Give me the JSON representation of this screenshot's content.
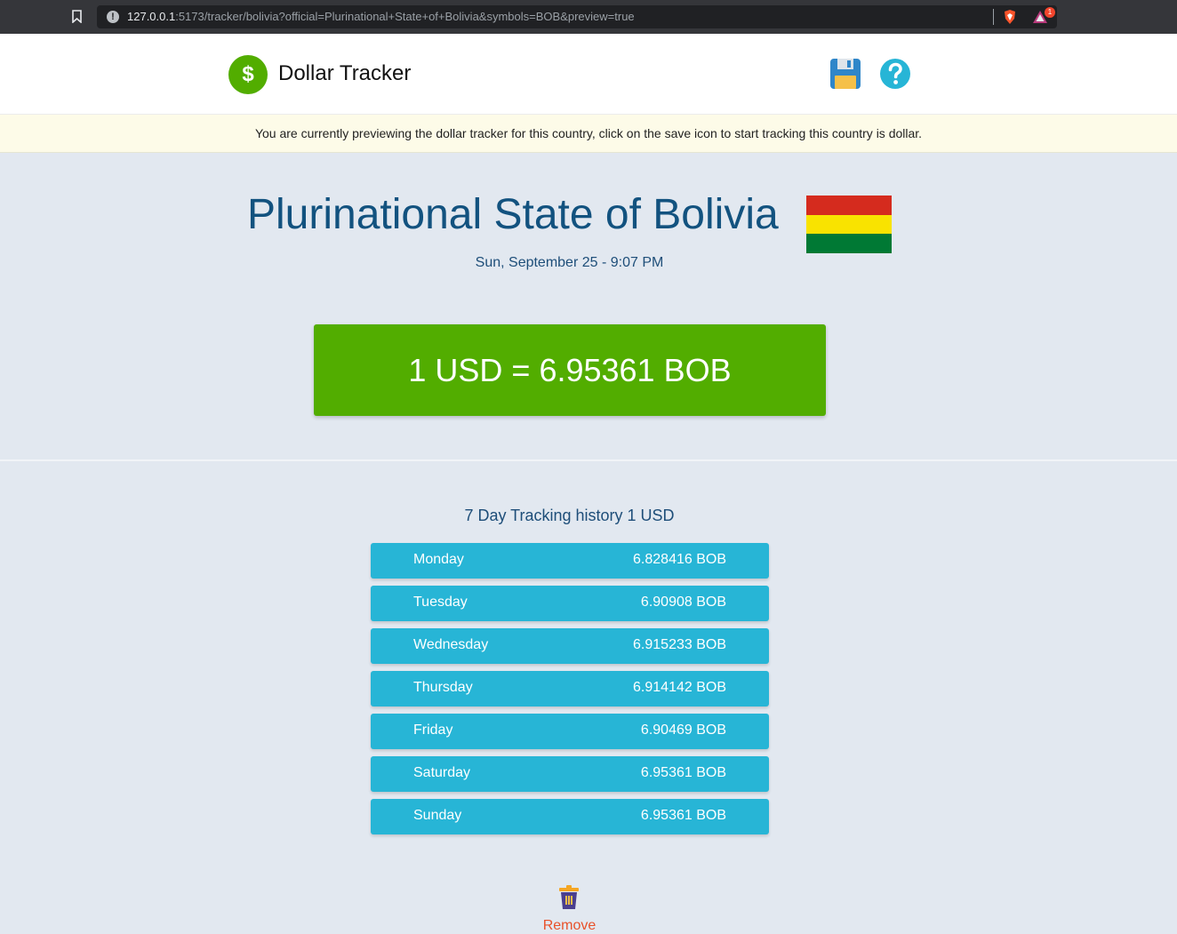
{
  "browser": {
    "url_host": "127.0.0.1",
    "url_rest": ":5173/tracker/bolivia?official=Plurinational+State+of+Bolivia&symbols=BOB&preview=true",
    "rewards_badge": "1"
  },
  "header": {
    "logo_symbol": "$",
    "app_title": "Dollar Tracker",
    "save_icon": "save-icon",
    "help_icon": "help-icon"
  },
  "notice": {
    "text": "You are currently previewing the dollar tracker for this country, click on the save icon to start tracking this country is dollar."
  },
  "country": {
    "name": "Plurinational State of Bolivia",
    "datetime": "Sun, September 25 - 9:07 PM",
    "flag_colors": [
      "#d52b1e",
      "#f9e300",
      "#007934"
    ]
  },
  "rate": {
    "text": "1 USD = 6.95361 BOB"
  },
  "history": {
    "title": "7 Day Tracking history 1 USD",
    "rows": [
      {
        "day": "Monday",
        "value": "6.828416 BOB"
      },
      {
        "day": "Tuesday",
        "value": "6.90908 BOB"
      },
      {
        "day": "Wednesday",
        "value": "6.915233 BOB"
      },
      {
        "day": "Thursday",
        "value": "6.914142 BOB"
      },
      {
        "day": "Friday",
        "value": "6.90469 BOB"
      },
      {
        "day": "Saturday",
        "value": "6.95361 BOB"
      },
      {
        "day": "Sunday",
        "value": "6.95361 BOB"
      }
    ]
  },
  "remove": {
    "label": "Remove"
  },
  "colors": {
    "accent_green": "#52ad00",
    "row_blue": "#27b5d6",
    "title_blue": "#12527f",
    "remove_red": "#e8522b"
  }
}
